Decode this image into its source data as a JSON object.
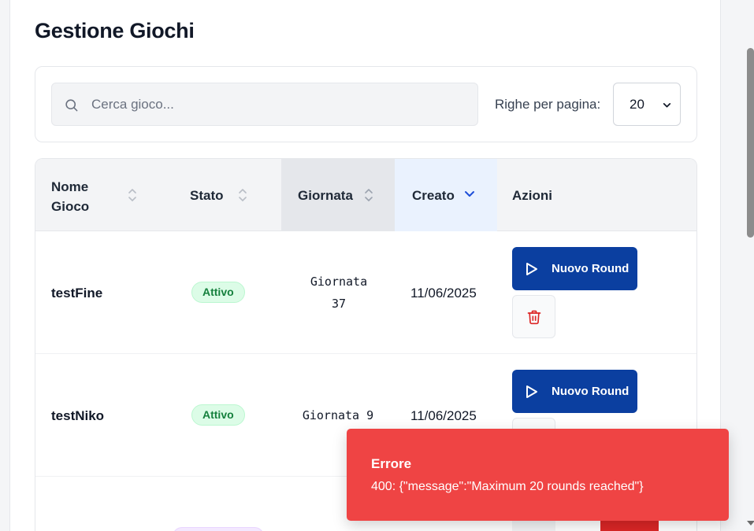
{
  "page": {
    "title": "Gestione Giochi"
  },
  "filters": {
    "search_placeholder": "Cerca gioco...",
    "search_value": "",
    "rows_label": "Righe per pagina:",
    "rows_value": "20"
  },
  "table": {
    "columns": {
      "nome": "Nome Gioco",
      "stato": "Stato",
      "giornata": "Giornata",
      "creato": "Creato",
      "azioni": "Azioni"
    },
    "sort": {
      "column": "creato",
      "direction": "desc"
    },
    "rows": [
      {
        "name": "testFine",
        "status": "Attivo",
        "giornata": "Giornata 37",
        "created": "11/06/2025",
        "round_button": "Nuovo Round"
      },
      {
        "name": "testNiko",
        "status": "Attivo",
        "giornata": "Giornata 9",
        "created": "11/06/2025",
        "round_button": "Nuovo Round"
      }
    ]
  },
  "toast": {
    "title": "Errore",
    "message": "400: {\"message\":\"Maximum 20 rounds reached\"}"
  },
  "colors": {
    "primary": "#0b3fa0",
    "danger": "#ef4444",
    "badge_active_bg": "#dcfce7",
    "badge_active_text": "#15803d"
  },
  "icons": {
    "search": "search-icon",
    "sort": "sort-icon",
    "sort_desc": "chevron-down-icon",
    "play": "play-icon",
    "delete": "trash-icon"
  }
}
